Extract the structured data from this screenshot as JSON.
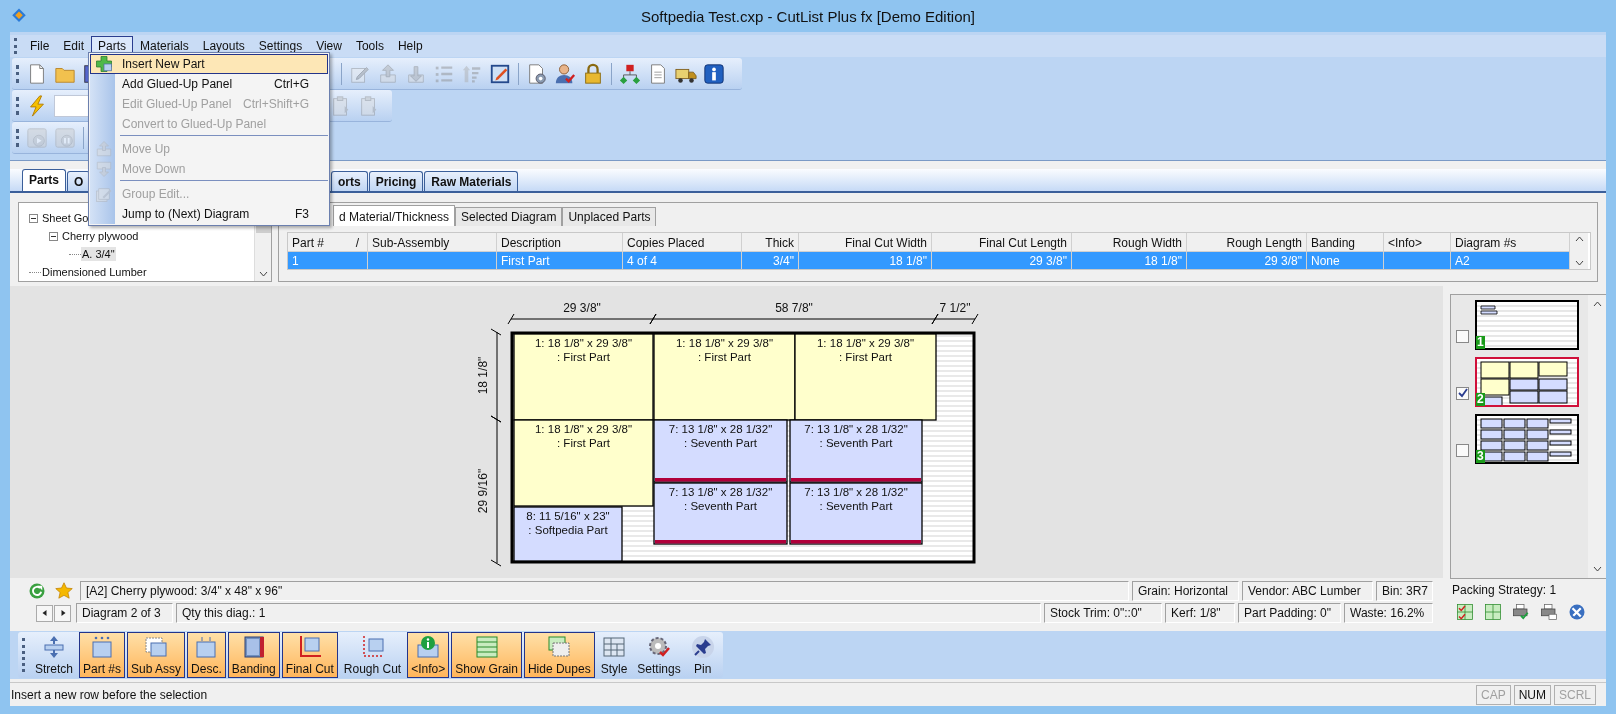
{
  "window": {
    "title": "Softpedia Test.cxp - CutList Plus fx [Demo Edition]"
  },
  "menu": [
    {
      "label": "File",
      "selected": false
    },
    {
      "label": "Edit",
      "selected": false
    },
    {
      "label": "Parts",
      "selected": true
    },
    {
      "label": "Materials",
      "selected": false
    },
    {
      "label": "Layouts",
      "selected": false
    },
    {
      "label": "Settings",
      "selected": false
    },
    {
      "label": "View",
      "selected": false
    },
    {
      "label": "Tools",
      "selected": false
    },
    {
      "label": "Help",
      "selected": false
    }
  ],
  "menu_dropdown": [
    {
      "kind": "item",
      "label": "Insert New Part",
      "disabled": false,
      "selected": true
    },
    {
      "kind": "item",
      "label": "Add Glued-Up Panel",
      "shortcut": "Ctrl+G",
      "disabled": false,
      "selected": false
    },
    {
      "kind": "item",
      "label": "Edit Glued-Up Panel",
      "shortcut": "Ctrl+Shift+G",
      "disabled": true,
      "selected": false
    },
    {
      "kind": "item",
      "label": "Convert to Glued-Up Panel",
      "disabled": true,
      "selected": false
    },
    {
      "kind": "separator"
    },
    {
      "kind": "item",
      "label": "Move Up",
      "disabled": true,
      "selected": false
    },
    {
      "kind": "item",
      "label": "Move Down",
      "disabled": true,
      "selected": false
    },
    {
      "kind": "separator"
    },
    {
      "kind": "item",
      "label": "Group Edit...",
      "disabled": true,
      "selected": false
    },
    {
      "kind": "item",
      "label": "Jump to (Next) Diagram",
      "shortcut": "F3",
      "disabled": false,
      "selected": false
    }
  ],
  "toolbar_1": [
    {
      "disabled": false
    },
    {
      "disabled": false
    },
    {
      "disabled": false
    },
    {
      "disabled": true
    },
    {
      "disabled": true
    },
    {
      "disabled": true
    },
    {
      "disabled": true
    },
    {
      "disabled": true
    },
    {
      "disabled": false
    },
    {
      "disabled": false
    },
    {
      "disabled": false
    },
    {
      "disabled": false
    },
    {
      "disabled": false
    },
    {
      "disabled": false
    },
    {
      "disabled": false
    },
    {
      "disabled": false
    }
  ],
  "toolbar_2": [
    {
      "kind": "button",
      "disabled": false
    },
    {
      "kind": "field"
    },
    {
      "kind": "button",
      "disabled": true
    },
    {
      "kind": "button",
      "disabled": true
    }
  ],
  "toolbar_3": [
    {
      "disabled": true
    },
    {
      "disabled": true
    }
  ],
  "tabs": [
    {
      "label": "Parts",
      "selected": true
    },
    {
      "label": "O",
      "selected": false
    },
    {
      "label": "orts",
      "selected": false
    },
    {
      "label": "Pricing",
      "selected": false
    },
    {
      "label": "Raw Materials",
      "selected": false
    }
  ],
  "tree": [
    {
      "label": "Sheet Go",
      "expanded": true,
      "selected": false,
      "children": [
        {
          "label": "Cherry plywood",
          "expanded": true,
          "selected": false,
          "children": [
            {
              "label": "A. 3/4\"",
              "selected": true
            }
          ]
        }
      ]
    },
    {
      "label": "Dimensioned Lumber",
      "selected": false
    }
  ],
  "sub_tabs": [
    {
      "label": "d Material/Thickness",
      "selected": true
    },
    {
      "label": "Selected Diagram",
      "selected": false
    },
    {
      "label": "Unplaced Parts",
      "selected": false
    }
  ],
  "table": {
    "columns": [
      "Part #",
      "Sub-Assembly",
      "Description",
      "Copies Placed",
      "Thick",
      "Final Cut Width",
      "Final Cut Length",
      "Rough Width",
      "Rough Length",
      "Banding",
      "<Info>",
      "Diagram #s"
    ],
    "sort_mark": "/",
    "rows": [
      {
        "selected": true,
        "cells": [
          "1",
          "",
          "First Part",
          "4 of 4",
          "3/4\"",
          "18 1/8\"",
          "29 3/8\"",
          "18 1/8\"",
          "29 3/8\"",
          "None",
          "",
          "A2"
        ]
      }
    ]
  },
  "diagram": {
    "top_dimensions": [
      "29 3/8\"",
      "58 7/8\"",
      "7 1/2\""
    ],
    "side_dimensions": [
      "18 1/8\"",
      "29 9/16\""
    ],
    "parts": [
      {
        "lines": [
          "1: 18 1/8\" x 29 3/8\"",
          ": First Part"
        ],
        "color": "#ffffcc",
        "banded": false
      },
      {
        "lines": [
          "1: 18 1/8\" x 29 3/8\"",
          ": First Part"
        ],
        "color": "#ffffcc",
        "banded": false
      },
      {
        "lines": [
          "1: 18 1/8\" x 29 3/8\"",
          ": First Part"
        ],
        "color": "#ffffcc",
        "banded": false
      },
      {
        "lines": [
          "1: 18 1/8\" x 29 3/8\"",
          ": First Part"
        ],
        "color": "#ffffcc",
        "banded": false
      },
      {
        "lines": [
          "7: 13 1/8\" x 28 1/32\"",
          ": Seventh Part"
        ],
        "color": "#d4dcff",
        "banded": true
      },
      {
        "lines": [
          "7: 13 1/8\" x 28 1/32\"",
          ": Seventh Part"
        ],
        "color": "#d4dcff",
        "banded": true
      },
      {
        "lines": [
          "7: 13 1/8\" x 28 1/32\"",
          ": Seventh Part"
        ],
        "color": "#d4dcff",
        "banded": true
      },
      {
        "lines": [
          "7: 13 1/8\" x 28 1/32\"",
          ": Seventh Part"
        ],
        "color": "#d4dcff",
        "banded": true
      },
      {
        "lines": [
          "8: 11 5/16\" x 23\"",
          ": Softpedia Part"
        ],
        "color": "#d4dcff",
        "banded": false
      }
    ]
  },
  "thumbnails": [
    {
      "number": "1",
      "checked": false,
      "selected": false
    },
    {
      "number": "2",
      "checked": true,
      "selected": true
    },
    {
      "number": "3",
      "checked": false,
      "selected": false
    }
  ],
  "info_bar": {
    "stock": "[A2] Cherry plywood: 3/4\" x 48\" x 96\"",
    "grain": "Grain: Horizontal",
    "vendor": "Vendor: ABC Lumber",
    "bin": "Bin: 3R7",
    "diagram": "Diagram 2 of 3",
    "qty": "Qty this diag.: 1",
    "stock_trim": "Stock Trim: 0\"::0\"",
    "kerf": "Kerf: 1/8\"",
    "padding": "Part Padding: 0\"",
    "waste": "Waste: 16.2%"
  },
  "packing_strategy": "Packing Strategy: 1",
  "view_toolbar": [
    {
      "label": "Stretch",
      "on": false
    },
    {
      "label": "Part #s",
      "on": true
    },
    {
      "label": "Sub Assy",
      "on": true
    },
    {
      "label": "Desc.",
      "on": true
    },
    {
      "label": "Banding",
      "on": true
    },
    {
      "label": "Final Cut",
      "on": true
    },
    {
      "label": "Rough Cut",
      "on": false
    },
    {
      "label": "<Info>",
      "on": true
    },
    {
      "label": "Show Grain",
      "on": true
    },
    {
      "label": "Hide Dupes",
      "on": true
    },
    {
      "label": "Style",
      "on": false
    },
    {
      "label": "Settings",
      "on": false
    },
    {
      "label": "Pin",
      "on": false
    }
  ],
  "status_bar": {
    "message": "Insert a new row before the selection",
    "indicators": [
      {
        "label": "CAP",
        "on": false
      },
      {
        "label": "NUM",
        "on": true
      },
      {
        "label": "SCRL",
        "on": false
      }
    ]
  }
}
